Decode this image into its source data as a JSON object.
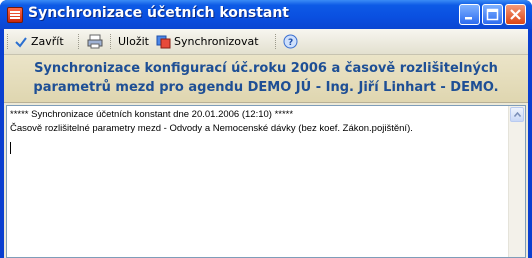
{
  "window": {
    "title": "Synchronizace účetních konstant"
  },
  "toolbar": {
    "close_label": "Zavřít",
    "save_label": "Uložit",
    "sync_label": "Synchronizovat"
  },
  "header": {
    "line1": "Synchronizace konfigurací úč.roku 2006 a časově rozlišitelných",
    "line2": "parametrů mezd pro agendu DEMO JÚ - Ing. Jiří Linhart - DEMO."
  },
  "log": {
    "lines": [
      "***** Synchronizace účetních konstant dne 20.01.2006 (12:10) *****",
      "Časově rozlišitelné parametry mezd - Odvody a Nemocenské dávky (bez koef. Zákon.pojištění)."
    ]
  },
  "colors": {
    "titlebar": "#0a4fe0",
    "header_text": "#1e4f95",
    "panel": "#ece9d8"
  }
}
